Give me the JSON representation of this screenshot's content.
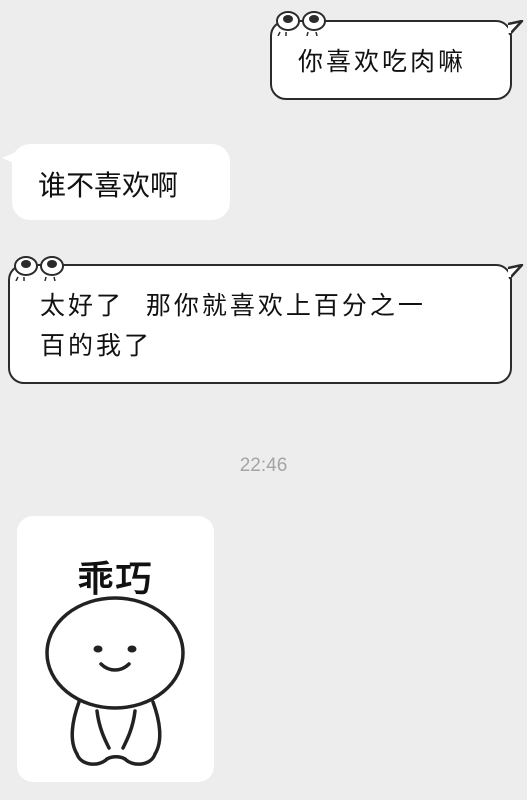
{
  "messages": [
    {
      "sender": "self",
      "style": "comic",
      "text": "你喜欢吃肉嘛"
    },
    {
      "sender": "other",
      "style": "plain",
      "text": "谁不喜欢啊"
    },
    {
      "sender": "self",
      "style": "comic",
      "text_line1": "太好了  那你就喜欢上百分之一",
      "text_line2": "百的我了"
    }
  ],
  "timestamp": "22:46",
  "sticker": {
    "caption": "乖巧",
    "icon": "smiling-blob-character"
  },
  "colors": {
    "background": "#ededed",
    "bubble": "#ffffff",
    "outline": "#2b2b2b",
    "timestamp": "#a4a4a4"
  }
}
